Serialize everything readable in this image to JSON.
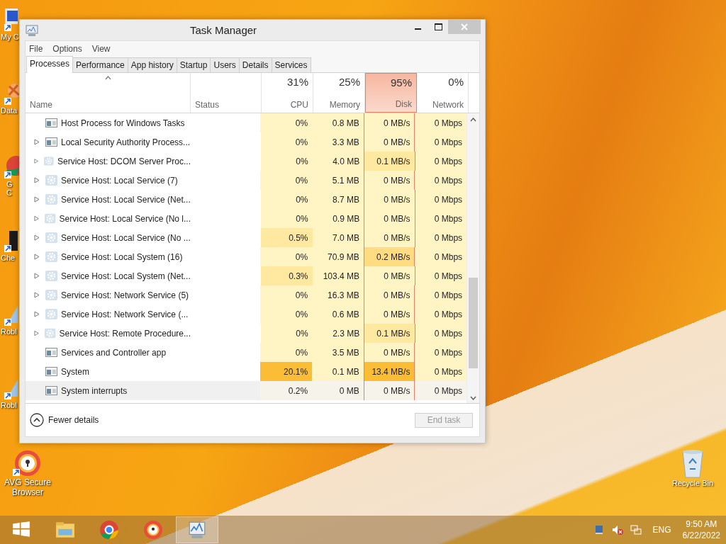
{
  "desktop_icons": [
    {
      "kind": "computer",
      "label": "My C"
    },
    {
      "kind": "data",
      "label": "Data"
    },
    {
      "kind": "browser",
      "label": "G C"
    },
    {
      "kind": "puzzle",
      "label": "Che"
    },
    {
      "kind": "game",
      "label": "Robl"
    },
    {
      "kind": "game",
      "label": "Robl"
    },
    {
      "kind": "avg",
      "label": "AVG Secure Browser"
    }
  ],
  "recycle_bin": {
    "label": "Recycle Bin"
  },
  "window": {
    "title": "Task Manager",
    "menu": [
      "File",
      "Options",
      "View"
    ],
    "tabs": [
      {
        "label": "Processes",
        "selected": true
      },
      {
        "label": "Performance",
        "selected": false
      },
      {
        "label": "App history",
        "selected": false
      },
      {
        "label": "Startup",
        "selected": false
      },
      {
        "label": "Users",
        "selected": false
      },
      {
        "label": "Details",
        "selected": false
      },
      {
        "label": "Services",
        "selected": false
      }
    ],
    "columns": [
      {
        "label": "Name",
        "sorted": true
      },
      {
        "label": "Status"
      },
      {
        "percent": "31%",
        "label": "CPU",
        "alert": false
      },
      {
        "percent": "25%",
        "label": "Memory",
        "alert": false
      },
      {
        "percent": "95%",
        "label": "Disk",
        "alert": true
      },
      {
        "percent": "0%",
        "label": "Network",
        "alert": false
      }
    ],
    "rows": [
      {
        "kind": "app",
        "expandable": false,
        "selected": false,
        "cells": [
          {
            "text": "Host Process for Windows Tasks"
          },
          {
            "text": ""
          },
          {
            "text": "0%",
            "kind": "idle"
          },
          {
            "text": "0.8 MB",
            "kind": "idle"
          },
          {
            "text": "0 MB/s",
            "kind": "idle"
          },
          {
            "text": "0 Mbps",
            "kind": "idle"
          }
        ]
      },
      {
        "kind": "app",
        "expandable": true,
        "selected": false,
        "cells": [
          {
            "text": "Local Security Authority Process..."
          },
          {
            "text": ""
          },
          {
            "text": "0%",
            "kind": "idle"
          },
          {
            "text": "3.3 MB",
            "kind": "idle"
          },
          {
            "text": "0 MB/s",
            "kind": "idle"
          },
          {
            "text": "0 Mbps",
            "kind": "idle"
          }
        ]
      },
      {
        "kind": "service",
        "expandable": true,
        "selected": false,
        "cells": [
          {
            "text": "Service Host: DCOM Server Proc..."
          },
          {
            "text": ""
          },
          {
            "text": "0%",
            "kind": "idle"
          },
          {
            "text": "4.0 MB",
            "kind": "idle"
          },
          {
            "text": "0.1 MB/s",
            "kind": "active"
          },
          {
            "text": "0 Mbps",
            "kind": "idle"
          }
        ]
      },
      {
        "kind": "service",
        "expandable": true,
        "selected": false,
        "cells": [
          {
            "text": "Service Host: Local Service (7)"
          },
          {
            "text": ""
          },
          {
            "text": "0%",
            "kind": "idle"
          },
          {
            "text": "5.1 MB",
            "kind": "idle"
          },
          {
            "text": "0 MB/s",
            "kind": "idle"
          },
          {
            "text": "0 Mbps",
            "kind": "idle"
          }
        ]
      },
      {
        "kind": "service",
        "expandable": true,
        "selected": false,
        "cells": [
          {
            "text": "Service Host: Local Service (Net..."
          },
          {
            "text": ""
          },
          {
            "text": "0%",
            "kind": "idle"
          },
          {
            "text": "8.7 MB",
            "kind": "idle"
          },
          {
            "text": "0 MB/s",
            "kind": "idle"
          },
          {
            "text": "0 Mbps",
            "kind": "idle"
          }
        ]
      },
      {
        "kind": "service",
        "expandable": true,
        "selected": false,
        "cells": [
          {
            "text": "Service Host: Local Service (No l..."
          },
          {
            "text": ""
          },
          {
            "text": "0%",
            "kind": "idle"
          },
          {
            "text": "0.9 MB",
            "kind": "idle"
          },
          {
            "text": "0 MB/s",
            "kind": "idle"
          },
          {
            "text": "0 Mbps",
            "kind": "idle"
          }
        ]
      },
      {
        "kind": "service",
        "expandable": true,
        "selected": false,
        "cells": [
          {
            "text": "Service Host: Local Service (No ..."
          },
          {
            "text": ""
          },
          {
            "text": "0.5%",
            "kind": "active"
          },
          {
            "text": "7.0 MB",
            "kind": "idle"
          },
          {
            "text": "0 MB/s",
            "kind": "idle"
          },
          {
            "text": "0 Mbps",
            "kind": "idle"
          }
        ]
      },
      {
        "kind": "service",
        "expandable": true,
        "selected": false,
        "cells": [
          {
            "text": "Service Host: Local System (16)"
          },
          {
            "text": ""
          },
          {
            "text": "0%",
            "kind": "idle"
          },
          {
            "text": "70.9 MB",
            "kind": "idle"
          },
          {
            "text": "0.2 MB/s",
            "kind": "busy"
          },
          {
            "text": "0 Mbps",
            "kind": "idle"
          }
        ]
      },
      {
        "kind": "service",
        "expandable": true,
        "selected": false,
        "cells": [
          {
            "text": "Service Host: Local System (Net..."
          },
          {
            "text": ""
          },
          {
            "text": "0.3%",
            "kind": "active"
          },
          {
            "text": "103.4 MB",
            "kind": "idle"
          },
          {
            "text": "0 MB/s",
            "kind": "idle"
          },
          {
            "text": "0 Mbps",
            "kind": "idle"
          }
        ]
      },
      {
        "kind": "service",
        "expandable": true,
        "selected": false,
        "cells": [
          {
            "text": "Service Host: Network Service (5)"
          },
          {
            "text": ""
          },
          {
            "text": "0%",
            "kind": "idle"
          },
          {
            "text": "16.3 MB",
            "kind": "idle"
          },
          {
            "text": "0 MB/s",
            "kind": "idle"
          },
          {
            "text": "0 Mbps",
            "kind": "idle"
          }
        ]
      },
      {
        "kind": "service",
        "expandable": true,
        "selected": false,
        "cells": [
          {
            "text": "Service Host: Network Service (..."
          },
          {
            "text": ""
          },
          {
            "text": "0%",
            "kind": "idle"
          },
          {
            "text": "0.6 MB",
            "kind": "idle"
          },
          {
            "text": "0 MB/s",
            "kind": "idle"
          },
          {
            "text": "0 Mbps",
            "kind": "idle"
          }
        ]
      },
      {
        "kind": "service",
        "expandable": true,
        "selected": false,
        "cells": [
          {
            "text": "Service Host: Remote Procedure..."
          },
          {
            "text": ""
          },
          {
            "text": "0%",
            "kind": "idle"
          },
          {
            "text": "2.3 MB",
            "kind": "idle"
          },
          {
            "text": "0.1 MB/s",
            "kind": "active"
          },
          {
            "text": "0 Mbps",
            "kind": "idle"
          }
        ]
      },
      {
        "kind": "app",
        "expandable": false,
        "selected": false,
        "cells": [
          {
            "text": "Services and Controller app"
          },
          {
            "text": ""
          },
          {
            "text": "0%",
            "kind": "idle"
          },
          {
            "text": "3.5 MB",
            "kind": "idle"
          },
          {
            "text": "0 MB/s",
            "kind": "idle"
          },
          {
            "text": "0 Mbps",
            "kind": "idle"
          }
        ]
      },
      {
        "kind": "app",
        "expandable": false,
        "selected": false,
        "cells": [
          {
            "text": "System"
          },
          {
            "text": ""
          },
          {
            "text": "20.1%",
            "kind": "hot"
          },
          {
            "text": "0.1 MB",
            "kind": "idle"
          },
          {
            "text": "13.4 MB/s",
            "kind": "hot"
          },
          {
            "text": "0 Mbps",
            "kind": "idle"
          }
        ]
      },
      {
        "kind": "app",
        "expandable": false,
        "selected": true,
        "cells": [
          {
            "text": "System interrupts"
          },
          {
            "text": ""
          },
          {
            "text": "0.2%",
            "kind": "idle"
          },
          {
            "text": "0 MB",
            "kind": "idle"
          },
          {
            "text": "0 MB/s",
            "kind": "idle"
          },
          {
            "text": "0 Mbps",
            "kind": "idle"
          }
        ]
      }
    ],
    "fewer_details": "Fewer details",
    "end_task": {
      "label": "End task",
      "disabled": true
    }
  },
  "taskbar": {
    "items": [
      {
        "kind": "start",
        "selected": false
      },
      {
        "kind": "explorer",
        "selected": false
      },
      {
        "kind": "chrome",
        "selected": false
      },
      {
        "kind": "avg",
        "selected": false
      },
      {
        "kind": "taskmgr",
        "selected": true
      }
    ],
    "tray": {
      "language": "ENG",
      "time": "9:50 AM",
      "date": "6/22/2022"
    }
  }
}
